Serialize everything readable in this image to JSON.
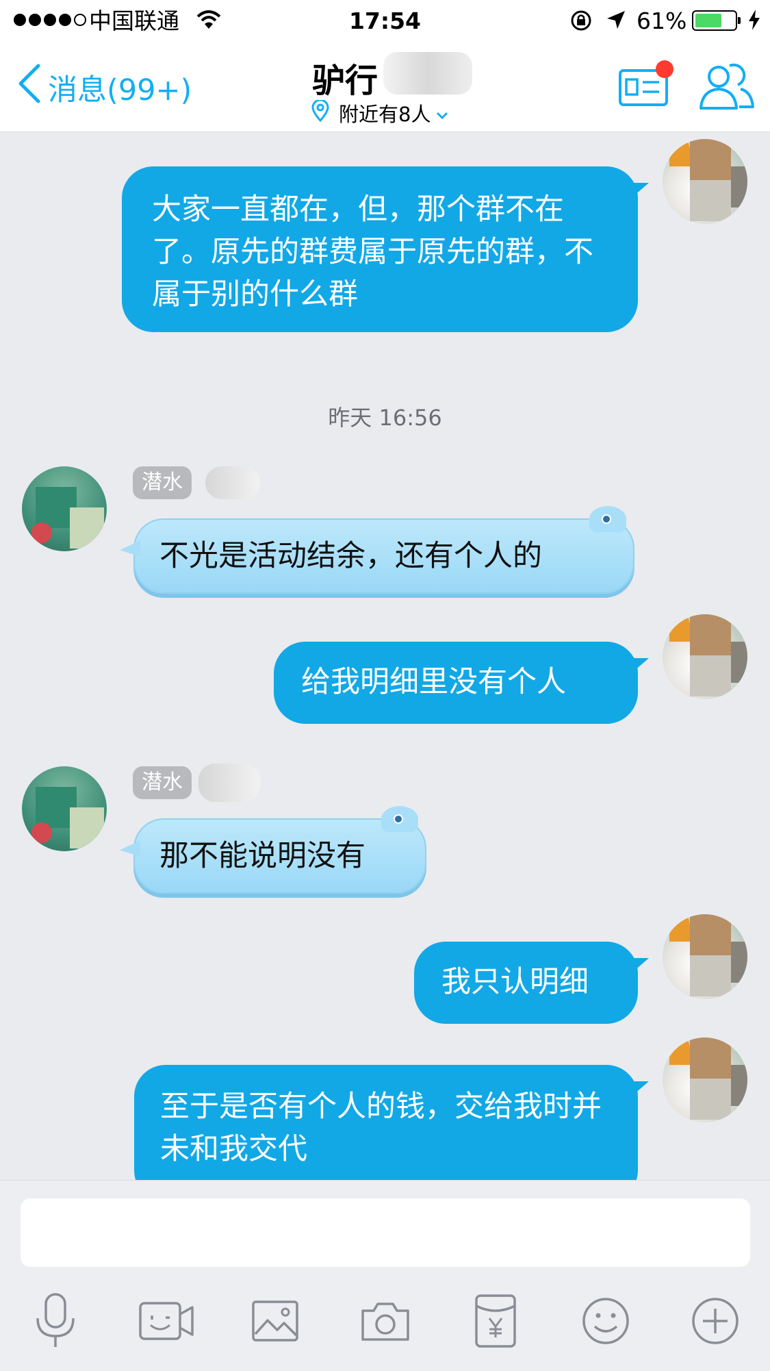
{
  "status_bar": {
    "carrier": "中国联通",
    "time": "17:54",
    "battery": "61%",
    "battery_level": 0.61
  },
  "nav": {
    "back_label": "消息(99+)",
    "title": "驴行",
    "nearby": "附近有8人",
    "accent": "#12aef4"
  },
  "messages": {
    "m1": "大家一直都在，但，那个群不在了。原先的群费属于原先的群，不属于别的什么群",
    "timestamp": "昨天 16:56",
    "m2_tag": "潜水",
    "m2": "不光是活动结余，还有个人的",
    "m3": "给我明细里没有个人",
    "m4_tag": "潜水",
    "m4": "那不能说明没有",
    "m5": "我只认明细",
    "m6": "至于是否有个人的钱，交给我时并未和我交代"
  },
  "toolbar": {
    "icons": [
      "microphone-icon",
      "video-icon",
      "image-icon",
      "camera-icon",
      "red-packet-icon",
      "emoji-icon",
      "plus-icon"
    ],
    "icon_color": "#8a8d93"
  },
  "colors": {
    "outgoing_bubble": "#12a8e6",
    "incoming_bubble": "#a9def8",
    "background": "#e9ebef"
  }
}
